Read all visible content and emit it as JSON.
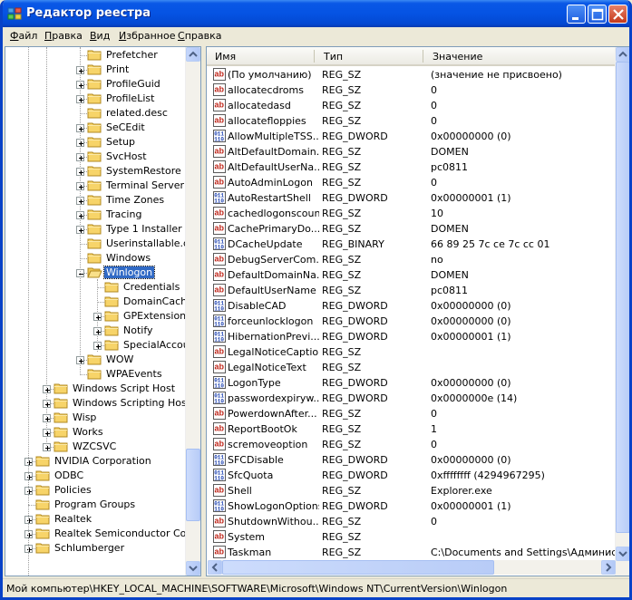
{
  "window": {
    "title": "Редактор реестра"
  },
  "menu": [
    {
      "label": "Файл",
      "key": "Ф"
    },
    {
      "label": "Правка",
      "key": "П"
    },
    {
      "label": "Вид",
      "key": "В"
    },
    {
      "label": "Избранное",
      "key": "И"
    },
    {
      "label": "Справка",
      "key": "С"
    }
  ],
  "tree": {
    "items": [
      {
        "label": "Prefetcher",
        "level": 3,
        "expander": "none"
      },
      {
        "label": "Print",
        "level": 3,
        "expander": "plus"
      },
      {
        "label": "ProfileGuid",
        "level": 3,
        "expander": "plus"
      },
      {
        "label": "ProfileList",
        "level": 3,
        "expander": "plus"
      },
      {
        "label": "related.desc",
        "level": 3,
        "expander": "none"
      },
      {
        "label": "SeCEdit",
        "level": 3,
        "expander": "plus"
      },
      {
        "label": "Setup",
        "level": 3,
        "expander": "plus"
      },
      {
        "label": "SvcHost",
        "level": 3,
        "expander": "plus"
      },
      {
        "label": "SystemRestore",
        "level": 3,
        "expander": "plus"
      },
      {
        "label": "Terminal Server",
        "level": 3,
        "expander": "plus"
      },
      {
        "label": "Time Zones",
        "level": 3,
        "expander": "plus"
      },
      {
        "label": "Tracing",
        "level": 3,
        "expander": "plus"
      },
      {
        "label": "Type 1 Installer",
        "level": 3,
        "expander": "plus"
      },
      {
        "label": "Userinstallable.dri",
        "level": 3,
        "expander": "none"
      },
      {
        "label": "Windows",
        "level": 3,
        "expander": "none"
      },
      {
        "label": "Winlogon",
        "level": 3,
        "expander": "minus",
        "selected": true,
        "open": true
      },
      {
        "label": "Credentials",
        "level": 4,
        "expander": "none"
      },
      {
        "label": "DomainCache",
        "level": 4,
        "expander": "none"
      },
      {
        "label": "GPExtensions",
        "level": 4,
        "expander": "plus"
      },
      {
        "label": "Notify",
        "level": 4,
        "expander": "plus"
      },
      {
        "label": "SpecialAccour",
        "level": 4,
        "expander": "plus"
      },
      {
        "label": "WOW",
        "level": 3,
        "expander": "plus"
      },
      {
        "label": "WPAEvents",
        "level": 3,
        "expander": "none"
      },
      {
        "label": "Windows Script Host",
        "level": 1,
        "expander": "plus"
      },
      {
        "label": "Windows Scripting Host",
        "level": 1,
        "expander": "plus"
      },
      {
        "label": "Wisp",
        "level": 1,
        "expander": "plus"
      },
      {
        "label": "Works",
        "level": 1,
        "expander": "plus"
      },
      {
        "label": "WZCSVC",
        "level": 1,
        "expander": "plus"
      },
      {
        "label": "NVIDIA Corporation",
        "level": 0,
        "expander": "plus"
      },
      {
        "label": "ODBC",
        "level": 0,
        "expander": "plus"
      },
      {
        "label": "Policies",
        "level": 0,
        "expander": "plus"
      },
      {
        "label": "Program Groups",
        "level": 0,
        "expander": "none"
      },
      {
        "label": "Realtek",
        "level": 0,
        "expander": "plus"
      },
      {
        "label": "Realtek Semiconductor Corp.",
        "level": 0,
        "expander": "plus"
      },
      {
        "label": "Schlumberger",
        "level": 0,
        "expander": "plus"
      }
    ]
  },
  "list": {
    "columns": [
      "Имя",
      "Тип",
      "Значение"
    ],
    "rows": [
      {
        "name": "(По умолчанию)",
        "type": "REG_SZ",
        "value": "(значение не присвоено)",
        "icon": "string"
      },
      {
        "name": "allocatecdroms",
        "type": "REG_SZ",
        "value": "0",
        "icon": "string"
      },
      {
        "name": "allocatedasd",
        "type": "REG_SZ",
        "value": "0",
        "icon": "string"
      },
      {
        "name": "allocatefloppies",
        "type": "REG_SZ",
        "value": "0",
        "icon": "string"
      },
      {
        "name": "AllowMultipleTSS...",
        "type": "REG_DWORD",
        "value": "0x00000000 (0)",
        "icon": "binary"
      },
      {
        "name": "AltDefaultDomain...",
        "type": "REG_SZ",
        "value": "DOMEN",
        "icon": "string"
      },
      {
        "name": "AltDefaultUserNa...",
        "type": "REG_SZ",
        "value": "pc0811",
        "icon": "string"
      },
      {
        "name": "AutoAdminLogon",
        "type": "REG_SZ",
        "value": "0",
        "icon": "string"
      },
      {
        "name": "AutoRestartShell",
        "type": "REG_DWORD",
        "value": "0x00000001 (1)",
        "icon": "binary"
      },
      {
        "name": "cachedlogonscount",
        "type": "REG_SZ",
        "value": "10",
        "icon": "string"
      },
      {
        "name": "CachePrimaryDo...",
        "type": "REG_SZ",
        "value": "DOMEN",
        "icon": "string"
      },
      {
        "name": "DCacheUpdate",
        "type": "REG_BINARY",
        "value": "66 89 25 7c ce 7c cc 01",
        "icon": "binary"
      },
      {
        "name": "DebugServerCom...",
        "type": "REG_SZ",
        "value": "no",
        "icon": "string"
      },
      {
        "name": "DefaultDomainNa...",
        "type": "REG_SZ",
        "value": "DOMEN",
        "icon": "string"
      },
      {
        "name": "DefaultUserName",
        "type": "REG_SZ",
        "value": "pc0811",
        "icon": "string"
      },
      {
        "name": "DisableCAD",
        "type": "REG_DWORD",
        "value": "0x00000000 (0)",
        "icon": "binary"
      },
      {
        "name": "forceunlocklogon",
        "type": "REG_DWORD",
        "value": "0x00000000 (0)",
        "icon": "binary"
      },
      {
        "name": "HibernationPrevi...",
        "type": "REG_DWORD",
        "value": "0x00000001 (1)",
        "icon": "binary"
      },
      {
        "name": "LegalNoticeCaption",
        "type": "REG_SZ",
        "value": "",
        "icon": "string"
      },
      {
        "name": "LegalNoticeText",
        "type": "REG_SZ",
        "value": "",
        "icon": "string"
      },
      {
        "name": "LogonType",
        "type": "REG_DWORD",
        "value": "0x00000000 (0)",
        "icon": "binary"
      },
      {
        "name": "passwordexpiryw...",
        "type": "REG_DWORD",
        "value": "0x0000000e (14)",
        "icon": "binary"
      },
      {
        "name": "PowerdownAfter...",
        "type": "REG_SZ",
        "value": "0",
        "icon": "string"
      },
      {
        "name": "ReportBootOk",
        "type": "REG_SZ",
        "value": "1",
        "icon": "string"
      },
      {
        "name": "scremoveoption",
        "type": "REG_SZ",
        "value": "0",
        "icon": "string"
      },
      {
        "name": "SFCDisable",
        "type": "REG_DWORD",
        "value": "0x00000000 (0)",
        "icon": "binary"
      },
      {
        "name": "SfcQuota",
        "type": "REG_DWORD",
        "value": "0xffffffff (4294967295)",
        "icon": "binary"
      },
      {
        "name": "Shell",
        "type": "REG_SZ",
        "value": "Explorer.exe",
        "icon": "string"
      },
      {
        "name": "ShowLogonOptions",
        "type": "REG_DWORD",
        "value": "0x00000001 (1)",
        "icon": "binary"
      },
      {
        "name": "ShutdownWithou...",
        "type": "REG_SZ",
        "value": "0",
        "icon": "string"
      },
      {
        "name": "System",
        "type": "REG_SZ",
        "value": "",
        "icon": "string"
      },
      {
        "name": "Taskman",
        "type": "REG_SZ",
        "value": "C:\\Documents and Settings\\Администрат",
        "icon": "string"
      }
    ]
  },
  "status": {
    "path": "Мой компьютер\\HKEY_LOCAL_MACHINE\\SOFTWARE\\Microsoft\\Windows NT\\CurrentVersion\\Winlogon"
  },
  "colors": {
    "titlebar": "#0553e3",
    "selection": "#316ac5",
    "folder": "#f7d469"
  }
}
